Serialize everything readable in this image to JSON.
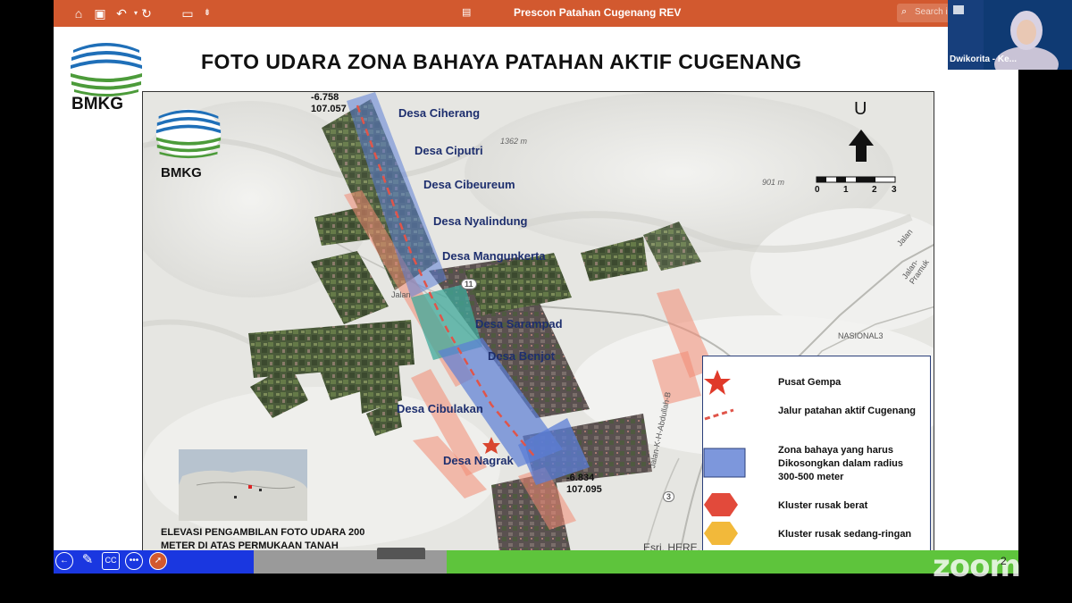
{
  "app": {
    "document_title": "Prescon Patahan Cugenang REV",
    "search_placeholder": "Search in Presentation"
  },
  "colors": {
    "toolbar": "#d2592f",
    "place_label": "#1e2f6e",
    "danger_zone": "#5b7ed6",
    "fault_line": "#e0554a",
    "severe_cluster": "#e24a3b",
    "moderate_cluster": "#f2b93a"
  },
  "slide": {
    "title": "FOTO UDARA ZONA BAHAYA PATAHAN AKTIF CUGENANG",
    "logo_text": "BMKG",
    "map_logo_text": "BMKG",
    "coord_nw": [
      "-6.758",
      "107.057"
    ],
    "coord_se": [
      "-6.834",
      "107.095"
    ],
    "villages": [
      "Desa Ciherang",
      "Desa Ciputri",
      "Desa Cibeureum",
      "Desa Nyalindung",
      "Desa Mangunkerta",
      "Desa Sarampad",
      "Desa Benjot",
      "Desa Cibulakan",
      "Desa Nagrak"
    ],
    "terrain_labels": [
      "1362 m",
      "901 m"
    ],
    "road_labels": [
      "Jalan",
      "Jalan-Pramuk",
      "Jalan",
      "NASIONAL3",
      "Jalan-K-H-Abdullah-B",
      "11",
      "3"
    ],
    "north_label": "U",
    "scale_ticks": [
      "0",
      "1",
      "2",
      "3"
    ],
    "elevation_caption": "ELEVASI PENGAMBILAN FOTO UDARA 200 METER DI ATAS PERMUKAAN TANAH",
    "attribution": "Esri, HERE,",
    "page_number": "2"
  },
  "legend": [
    {
      "icon": "star-icon",
      "label": "Pusat Gempa"
    },
    {
      "icon": "dashed-line-icon",
      "label": "Jalur patahan aktif Cugenang"
    },
    {
      "icon": "blue-rectangle-icon",
      "label": "Zona bahaya yang harus Dikosongkan dalam radius 300-500 meter"
    },
    {
      "icon": "red-hexagon-icon",
      "label": "Kluster rusak berat"
    },
    {
      "icon": "yellow-hexagon-icon",
      "label": "Kluster rusak sedang-ringan"
    }
  ],
  "video": {
    "participant_name": "Dwikorita - Ke..."
  },
  "watermark": "zoom"
}
